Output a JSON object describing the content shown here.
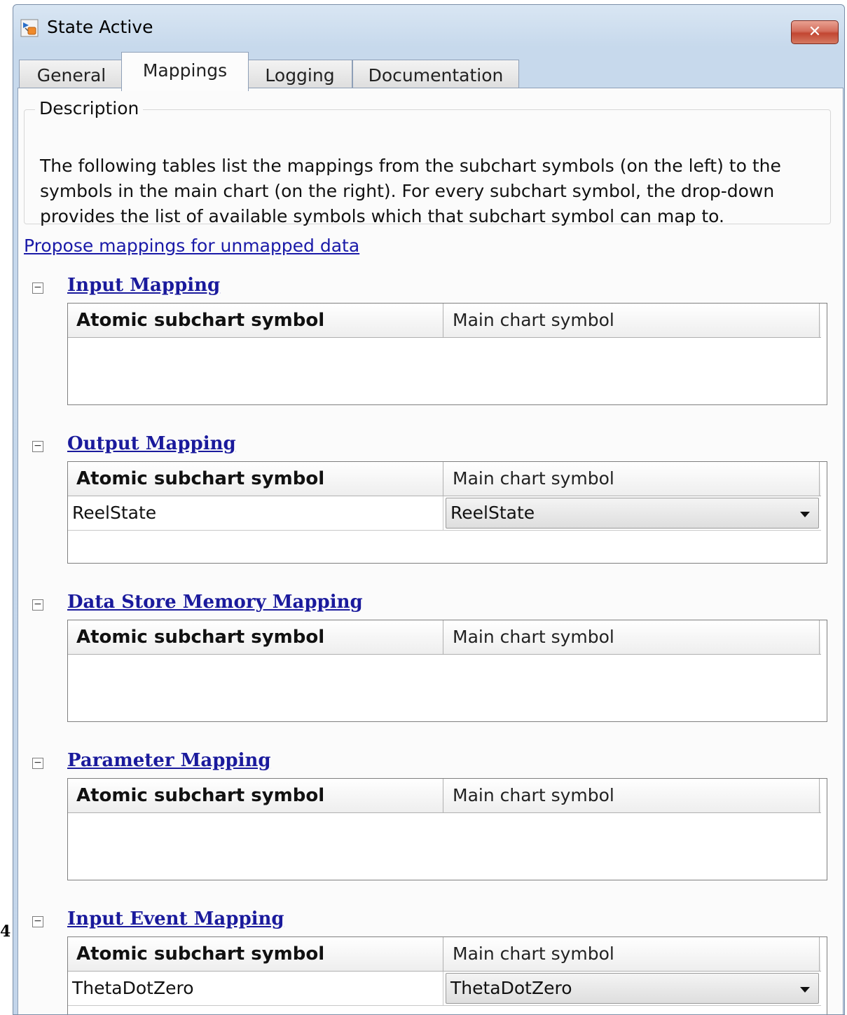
{
  "page_number": "4",
  "window": {
    "title": "State Active",
    "close_label": "✕",
    "icon": "stateflow-state-icon"
  },
  "tabs": [
    {
      "label": "General"
    },
    {
      "label": "Mappings",
      "active": true
    },
    {
      "label": "Logging"
    },
    {
      "label": "Documentation"
    }
  ],
  "description": {
    "legend": "Description",
    "text": "The following tables list the mappings from the subchart symbols (on the left) to the symbols in the main chart (on the right). For every subchart symbol, the drop-down provides the list of available symbols which that subchart symbol can map to."
  },
  "propose_link": "Propose mappings for unmapped data",
  "sections": {
    "input": {
      "title": "Input Mapping",
      "toggle": "−",
      "col_left": "Atomic subchart symbol",
      "col_right": "Main chart symbol"
    },
    "output": {
      "title": "Output Mapping",
      "toggle": "−",
      "col_left": "Atomic subchart symbol",
      "col_right": "Main chart symbol",
      "rows": [
        {
          "symbol": "ReelState",
          "main": "ReelState"
        }
      ]
    },
    "dsm": {
      "title": "Data Store Memory Mapping",
      "toggle": "−",
      "col_left": "Atomic subchart symbol",
      "col_right": "Main chart symbol"
    },
    "param": {
      "title": "Parameter Mapping",
      "toggle": "−",
      "col_left": "Atomic subchart symbol",
      "col_right": "Main chart symbol"
    },
    "input_event": {
      "title": "Input Event Mapping",
      "toggle": "−",
      "col_left": "Atomic subchart symbol",
      "col_right": "Main chart symbol",
      "rows": [
        {
          "symbol": "ThetaDotZero",
          "main": "ThetaDotZero"
        }
      ]
    }
  },
  "colors": {
    "link": "#1a1aa8",
    "frame": "#c7d9ec",
    "close": "#c24632"
  }
}
